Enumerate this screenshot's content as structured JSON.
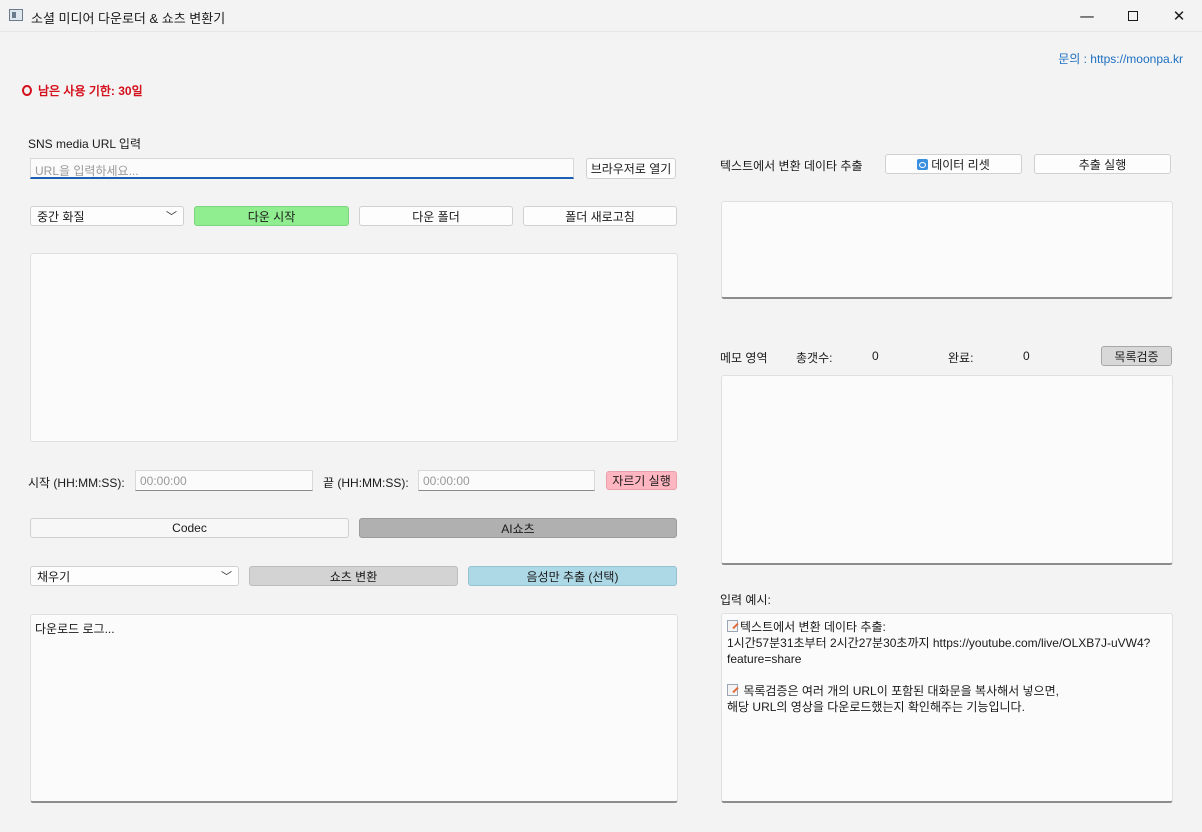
{
  "window": {
    "title": "소셜 미디어 다운로더 & 쇼츠 변환기",
    "minimize": "—",
    "close": "✕"
  },
  "header": {
    "contact_link": "문의 : https://moonpa.kr",
    "remaining_days": "남은 사용 기한: 30일"
  },
  "left": {
    "url_label": "SNS media URL 입력",
    "url_placeholder": "URL을 입력하세요...",
    "open_browser": "브라우저로 열기",
    "quality_selected": "중간 화질",
    "start_download": "다운 시작",
    "download_folder": "다운 폴더",
    "refresh_folder": "폴더 새로고침",
    "start_label": "시작 (HH:MM:SS):",
    "start_placeholder": "00:00:00",
    "end_label": "끝 (HH:MM:SS):",
    "end_placeholder": "00:00:00",
    "cut_button": "자르기 실행",
    "tab_codec": "Codec",
    "tab_ai_shorts": "AI쇼츠",
    "fill_selected": "채우기",
    "convert_shorts": "쇼츠 변환",
    "extract_audio": "음성만 추출 (선택)",
    "log_text": "다운로드 로그..."
  },
  "right": {
    "extract_label": "텍스트에서 변환 데이타 추출",
    "data_reset": "데이터 리셋",
    "run_extract": "추출 실행",
    "memo_label": "메모 영역",
    "total_label": "총갯수:",
    "total_value": "0",
    "done_label": "완료:",
    "done_value": "0",
    "verify_list": "목록검증",
    "example_label": "입력 예시:",
    "example_line1": "텍스트에서 변환 데이타 추출:",
    "example_line2": "1시간57분31초부터 2시간27분30초까지 https://youtube.com/live/OLXB7J-uVW4?feature=share",
    "example_line3": " 목록검증은 여러 개의 URL이 포함된 대화문을 복사해서 넣으면,",
    "example_line4": "해당 URL의 영상을 다운로드했는지 확인해주는 기능입니다."
  }
}
